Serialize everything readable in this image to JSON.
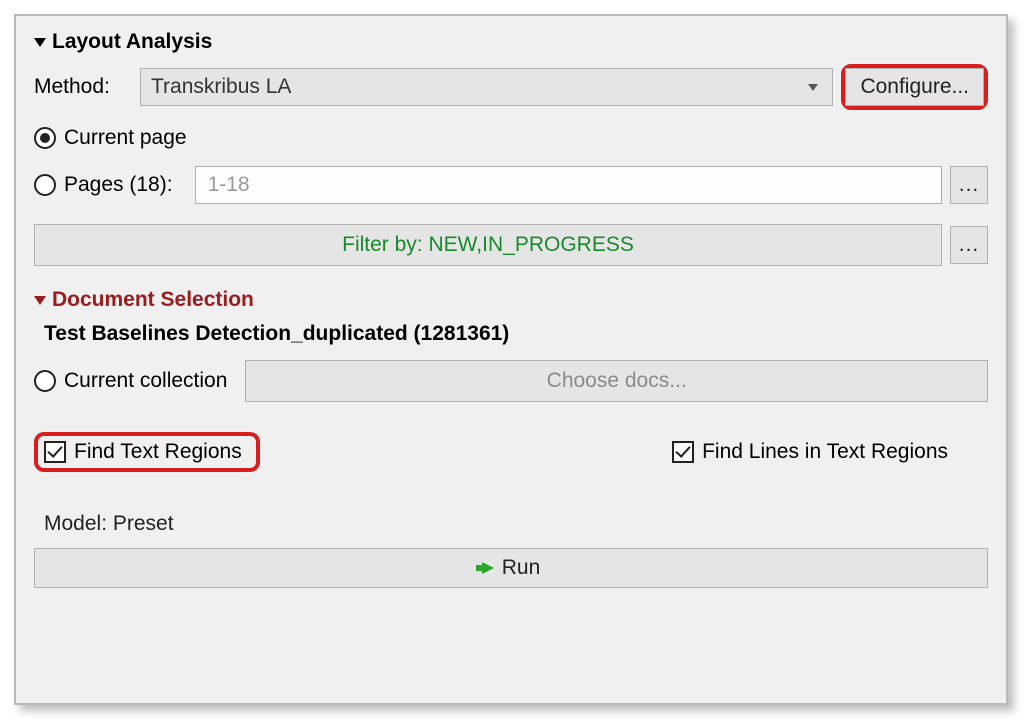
{
  "section_layout_title": "Layout Analysis",
  "method_label": "Method:",
  "method_value": "Transkribus LA",
  "configure_label": "Configure...",
  "radio_current_page": "Current page",
  "radio_pages_label": "Pages (18):",
  "pages_placeholder": "1-18",
  "ellipsis": "...",
  "filter_label": "Filter by: NEW,IN_PROGRESS",
  "section_docsel_title": "Document Selection",
  "doc_title": "Test Baselines Detection_duplicated (1281361)",
  "radio_current_collection": "Current collection",
  "choose_docs_label": "Choose docs...",
  "check_find_text_regions": "Find Text Regions",
  "check_find_lines": "Find Lines in Text Regions",
  "model_label": "Model: Preset",
  "run_label": "Run"
}
